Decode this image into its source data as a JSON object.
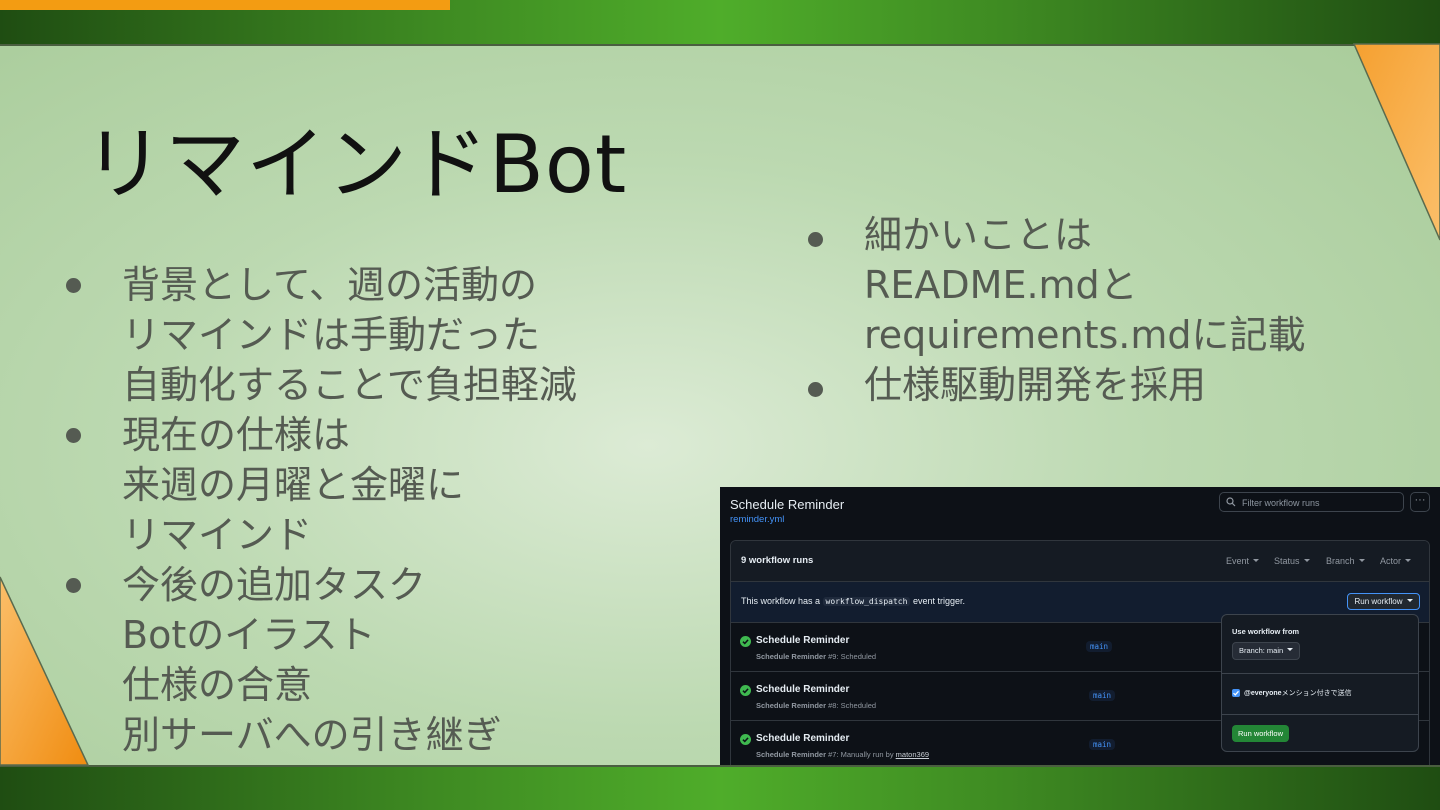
{
  "slide": {
    "title": "リマインドBot",
    "left_bullets": [
      {
        "lines": [
          "背景として、週の活動の",
          "リマインドは手動だった",
          "自動化することで負担軽減"
        ]
      },
      {
        "lines": [
          "現在の仕様は",
          "来週の月曜と金曜に",
          "リマインド"
        ]
      },
      {
        "lines": [
          "今後の追加タスク",
          "Botのイラスト",
          "仕様の合意",
          "別サーバへの引き継ぎ"
        ]
      }
    ],
    "right_bullets": [
      {
        "lines": [
          "細かいことは",
          "README.mdと",
          "requirements.mdに記載"
        ]
      },
      {
        "lines": [
          "仕様駆動開発を採用"
        ]
      }
    ],
    "colors": {
      "accent_orange": "#f39c12",
      "band_green": "#3e8a22",
      "text_gray": "#555b52"
    }
  },
  "github": {
    "workflow_title": "Schedule Reminder",
    "workflow_file": "reminder.yml",
    "filter_placeholder": "Filter workflow runs",
    "more_label": "···",
    "runs_count": "9 workflow runs",
    "filters": [
      "Event",
      "Status",
      "Branch",
      "Actor"
    ],
    "banner": {
      "prefix": "This workflow has a",
      "code": "workflow_dispatch",
      "suffix": "event trigger."
    },
    "run_button": "Run workflow",
    "runs": [
      {
        "name": "Schedule Reminder",
        "label": "Schedule Reminder",
        "detail": "#9: Scheduled",
        "by": "",
        "branch": "main"
      },
      {
        "name": "Schedule Reminder",
        "label": "Schedule Reminder",
        "detail": "#8: Scheduled",
        "by": "",
        "branch": "main"
      },
      {
        "name": "Schedule Reminder",
        "label": "Schedule Reminder",
        "detail": "#7: Manually run by",
        "by": "maton369",
        "branch": "main"
      }
    ],
    "dropdown": {
      "label": "Use workflow from",
      "branch_select": "Branch: main",
      "checkbox_label_bold": "@everyone",
      "checkbox_label_rest": "メンション付きで送信",
      "run_button": "Run workflow"
    },
    "colors": {
      "bg": "#0d1117",
      "link_blue": "#4493f8",
      "success_green": "#3fb950",
      "button_green": "#238636"
    }
  }
}
